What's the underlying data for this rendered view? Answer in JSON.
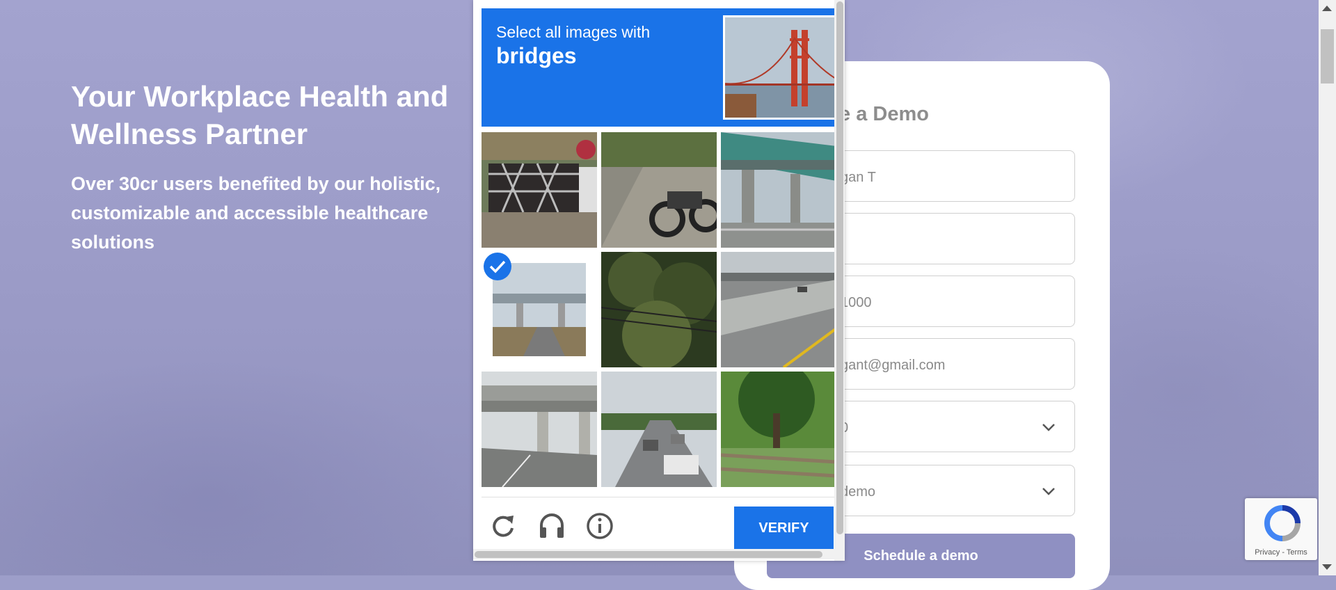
{
  "hero": {
    "title": "Your Workplace Health and Wellness Partner",
    "subtitle": "Over 30cr users benefited by our holistic, customizable and accessible healthcare solutions"
  },
  "form": {
    "title": "e a Demo",
    "fields": [
      {
        "value": "gan T"
      },
      {
        "value": ""
      },
      {
        "value": "1000"
      },
      {
        "value": "gant@gmail.com"
      },
      {
        "value": "0"
      },
      {
        "value": "demo"
      }
    ],
    "submit_label": "Schedule a demo"
  },
  "captcha": {
    "instruction": "Select all images with",
    "keyword": "bridges",
    "tiles": [
      {
        "subject": "fence-garden",
        "selected": false
      },
      {
        "subject": "motorcycle",
        "selected": false
      },
      {
        "subject": "bridge-overpass",
        "selected": false
      },
      {
        "subject": "bridge-road",
        "selected": true
      },
      {
        "subject": "trees-wires",
        "selected": false
      },
      {
        "subject": "highway",
        "selected": false
      },
      {
        "subject": "overpass",
        "selected": false
      },
      {
        "subject": "traffic",
        "selected": false
      },
      {
        "subject": "tree-fence",
        "selected": false
      }
    ],
    "footer_icons": [
      "reload-icon",
      "audio-icon",
      "info-icon"
    ],
    "verify_label": "VERIFY",
    "accent": "#1a73e8"
  },
  "recaptcha_badge": {
    "links": "Privacy - Terms"
  }
}
